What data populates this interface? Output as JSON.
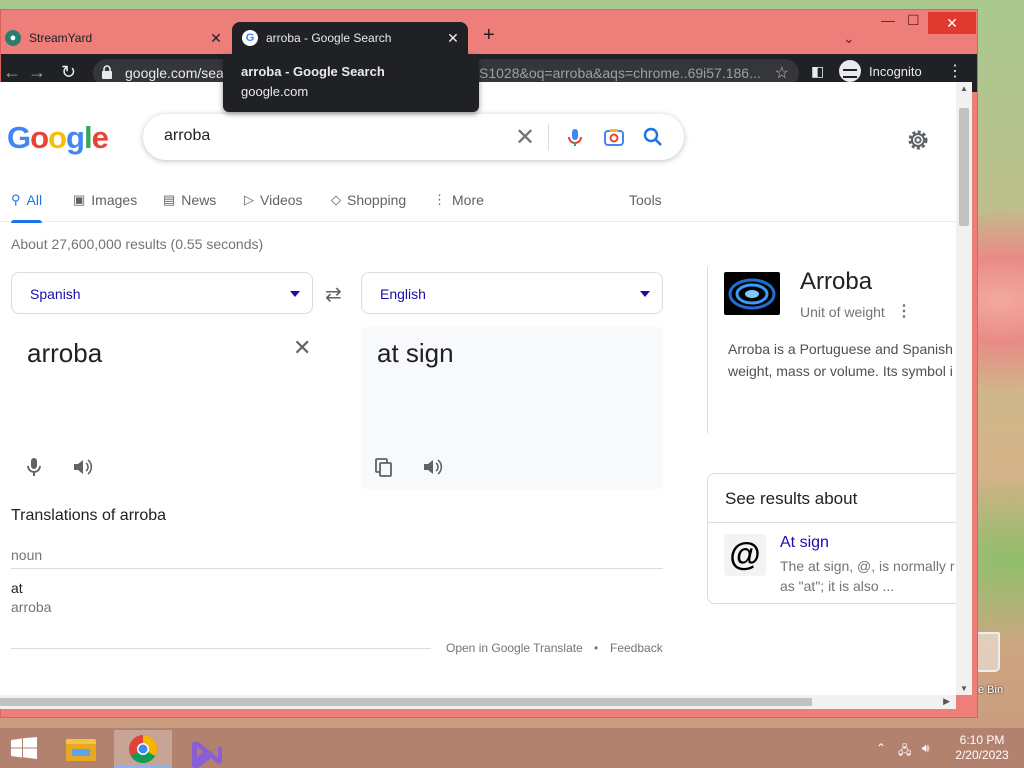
{
  "browser": {
    "tabs": [
      {
        "title": "StreamYard",
        "active": false
      },
      {
        "title": "arroba - Google Search",
        "active": true
      }
    ],
    "new_tab": "+",
    "address_host": "google.com/sea",
    "address_tail": "S1028&oq=arroba&aqs=chrome..69i57.186...",
    "profile_label": "Incognito",
    "tooltip": {
      "title": "arroba - Google Search",
      "host": "google.com"
    }
  },
  "page": {
    "logo": [
      "G",
      "o",
      "o",
      "g",
      "l",
      "e"
    ],
    "search_query": "arroba",
    "vertical_tabs": [
      {
        "label": "All",
        "selected": true
      },
      {
        "label": "Images",
        "selected": false
      },
      {
        "label": "News",
        "selected": false
      },
      {
        "label": "Videos",
        "selected": false
      },
      {
        "label": "Shopping",
        "selected": false
      },
      {
        "label": "More",
        "selected": false
      }
    ],
    "tools_label": "Tools",
    "result_stats": "About 27,600,000 results (0.55 seconds)",
    "translate": {
      "source_lang": "Spanish",
      "target_lang": "English",
      "source_text": "arroba",
      "target_text": "at sign",
      "translations_heading": "Translations of arroba",
      "part_of_speech": "noun",
      "word": "at",
      "back_translation": "arroba",
      "open_link": "Open in Google Translate",
      "separator": "•",
      "feedback": "Feedback"
    },
    "knowledge_panel": {
      "title": "Arroba",
      "subtitle": "Unit of weight",
      "description_lines": [
        "Arroba is a Portuguese and Spanish",
        "weight, mass or volume. Its symbol i"
      ]
    },
    "see_results_about": {
      "heading": "See results about",
      "icon_glyph": "@",
      "item_title": "At sign",
      "item_desc_lines": [
        "The at sign, @, is normally r",
        "as \"at\"; it is also ..."
      ]
    }
  },
  "desktop": {
    "recycle_bin_label": "e Bin",
    "clock_time": "6:10 PM",
    "clock_date": "2/20/2023"
  },
  "colors": {
    "window_frame": "#ed7e79",
    "link_blue": "#1a0dab",
    "accent_blue": "#1a73e8",
    "toolbar_dark": "#202124"
  }
}
